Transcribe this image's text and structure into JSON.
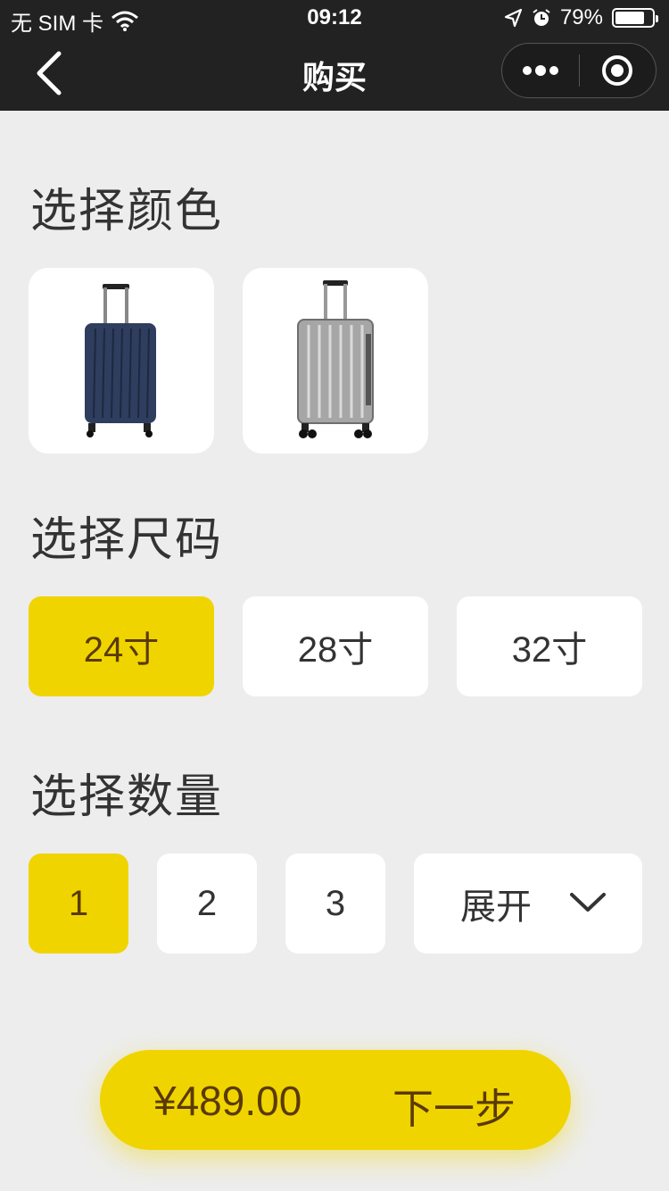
{
  "status_bar": {
    "carrier": "无 SIM 卡",
    "time": "09:12",
    "battery_percent": "79%",
    "battery_level": 0.79,
    "icons": [
      "wifi-icon",
      "location-arrow-icon",
      "alarm-icon",
      "battery-icon"
    ]
  },
  "nav": {
    "title": "购买",
    "back_icon": "chevron-left-icon",
    "more_icon": "more-dots-icon",
    "close_icon": "target-circle-icon"
  },
  "color_section": {
    "title": "选择颜色",
    "options": [
      {
        "name": "navy",
        "color": "#2f3e5e",
        "selected": false
      },
      {
        "name": "silver",
        "color": "#a6a6a6",
        "selected": false
      }
    ]
  },
  "size_section": {
    "title": "选择尺码",
    "options": [
      {
        "label": "24寸",
        "selected": true
      },
      {
        "label": "28寸",
        "selected": false
      },
      {
        "label": "32寸",
        "selected": false
      }
    ]
  },
  "quantity_section": {
    "title": "选择数量",
    "options": [
      {
        "label": "1",
        "selected": true
      },
      {
        "label": "2",
        "selected": false
      },
      {
        "label": "3",
        "selected": false
      }
    ],
    "expand_label": "展开",
    "expand_icon": "chevron-down-icon"
  },
  "footer": {
    "price": "¥489.00",
    "next_label": "下一步"
  },
  "colors": {
    "accent": "#f0d400",
    "accent_text": "#5a3a00",
    "background": "#ededed",
    "header": "#222222"
  }
}
